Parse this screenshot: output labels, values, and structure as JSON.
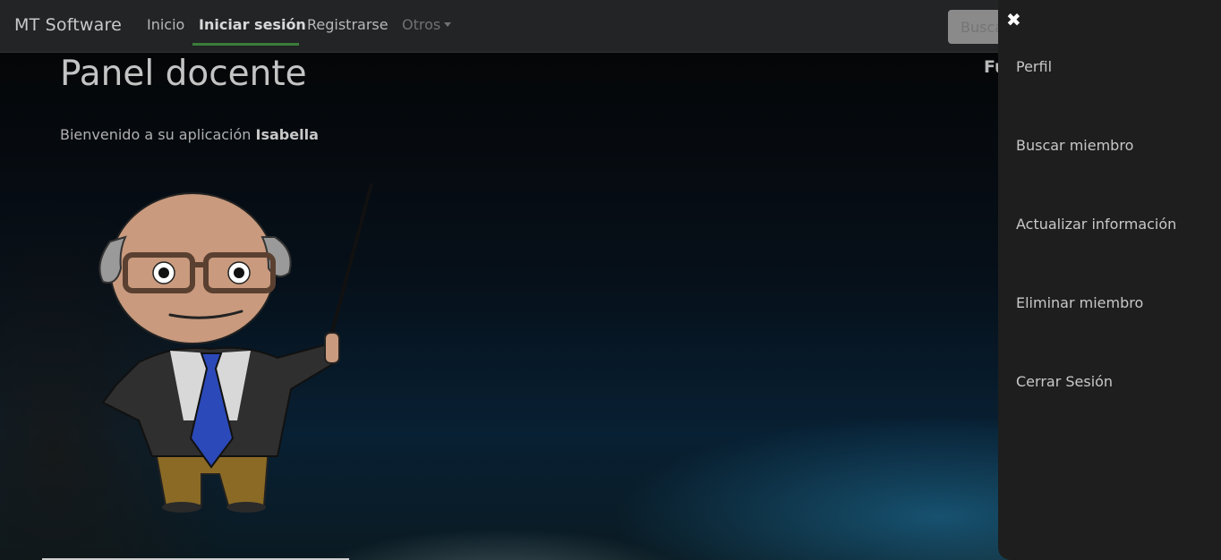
{
  "navbar": {
    "brand": "MT Software",
    "links": [
      {
        "label": "Inicio"
      },
      {
        "label": "Iniciar sesión"
      },
      {
        "label": "Registrarse"
      },
      {
        "label": "Otros"
      }
    ],
    "search_placeholder": "Busca"
  },
  "main": {
    "title": "Panel docente",
    "welcome_text": "Bienvenido a su aplicación",
    "user_name": "Isabella",
    "partial_heading": "Fu"
  },
  "sidebar": {
    "close_icon": "✖",
    "items": [
      {
        "label": "Perfil"
      },
      {
        "label": "Buscar miembro"
      },
      {
        "label": "Actualizar información"
      },
      {
        "label": "Eliminar miembro"
      },
      {
        "label": "Cerrar Sesión"
      }
    ]
  },
  "colors": {
    "navbar_bg": "#222426",
    "sidebar_bg": "#1e1e1e",
    "active_underline": "#3a7d3a"
  }
}
